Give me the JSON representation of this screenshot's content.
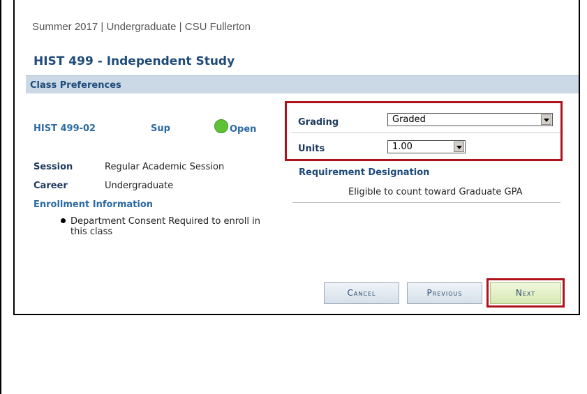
{
  "header": {
    "term": "Summer 2017 | Undergraduate | CSU Fullerton",
    "course_title": "HIST  499 - Independent Study"
  },
  "section": {
    "title": "Class Preferences"
  },
  "class_info": {
    "code": "HIST 499-02",
    "component": "Sup",
    "status": "Open",
    "status_color": "#5ec236",
    "session_label": "Session",
    "session_value": "Regular Academic Session",
    "career_label": "Career",
    "career_value": "Undergraduate",
    "enrollment_heading": "Enrollment Information",
    "enrollment_items": [
      "Department Consent Required to enroll in this class"
    ]
  },
  "preferences": {
    "grading_label": "Grading",
    "grading_value": "Graded",
    "units_label": "Units",
    "units_value": "1.00",
    "requirement_heading": "Requirement Designation",
    "requirement_text": "Eligible to count toward Graduate GPA"
  },
  "buttons": {
    "cancel": "Cancel",
    "previous": "Previous",
    "next": "Next"
  },
  "colors": {
    "highlight_border": "#b0121b",
    "section_bar": "#cbd8e6",
    "link_blue": "#2b6aa3"
  }
}
